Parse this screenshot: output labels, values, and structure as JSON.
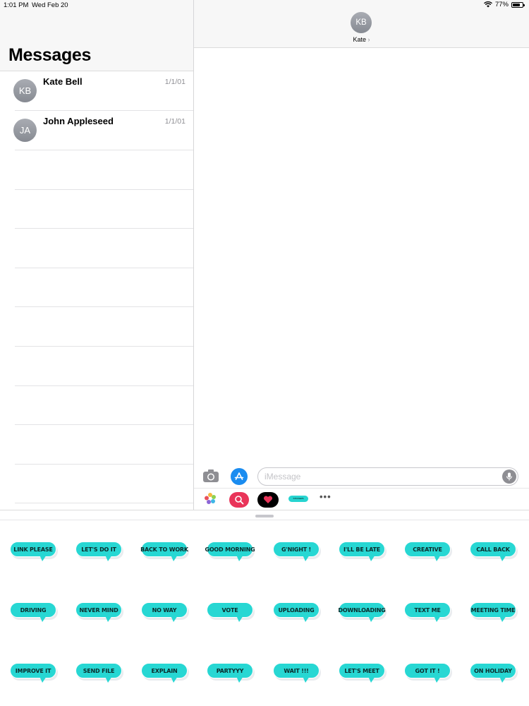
{
  "status": {
    "time": "1:01 PM",
    "date": "Wed Feb 20",
    "battery": "77%"
  },
  "sidebar": {
    "title": "Messages",
    "conversations": [
      {
        "initials": "KB",
        "name": "Kate Bell",
        "date": "1/1/01"
      },
      {
        "initials": "JA",
        "name": "John Appleseed",
        "date": "1/1/01"
      }
    ]
  },
  "chat": {
    "contact_initials": "KB",
    "contact_name": "Kate",
    "contact_chevron": "›",
    "input_placeholder": "iMessage"
  },
  "app_strip": {
    "more_label": "•••",
    "sticker_app_label": "STICKERS"
  },
  "stickers": [
    "LINK PLEASE",
    "LET'S DO IT",
    "BACK TO WORK",
    "GOOD MORNING",
    "G'NIGHT !",
    "I'LL BE LATE",
    "CREATIVE",
    "CALL BACK",
    "DRIVING",
    "NEVER MIND",
    "NO WAY",
    "VOTE",
    "UPLOADING",
    "DOWNLOADING",
    "TEXT ME",
    "MEETING TIME",
    "IMPROVE IT",
    "SEND FILE",
    "EXPLAIN",
    "PARTYYY",
    "WAIT !!!",
    "LET'S MEET",
    "GOT IT !",
    "ON HOLIDAY"
  ],
  "colors": {
    "sticker_fill": "#27d7d3",
    "avatar_gray": "#9a9da4",
    "appstore_blue": "#1a8cf0",
    "search_app_pink": "#e93459"
  }
}
